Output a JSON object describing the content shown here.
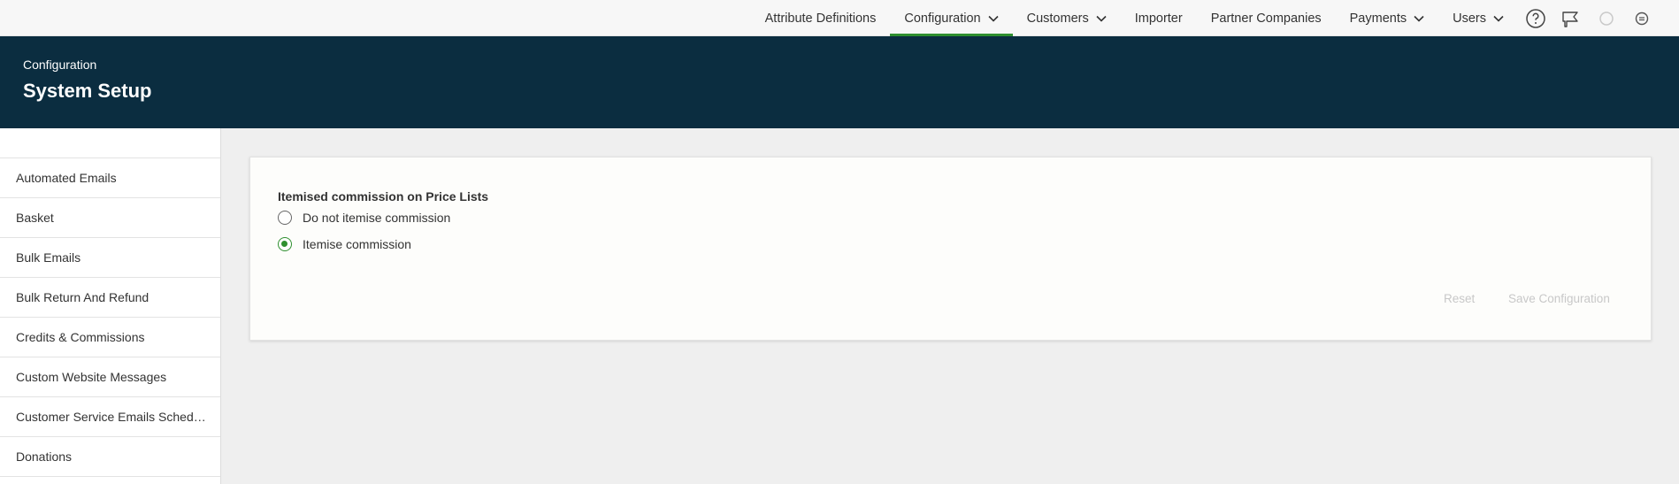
{
  "topnav": {
    "items": [
      {
        "label": "Attribute Definitions",
        "dropdown": false,
        "active": false
      },
      {
        "label": "Configuration",
        "dropdown": true,
        "active": true
      },
      {
        "label": "Customers",
        "dropdown": true,
        "active": false
      },
      {
        "label": "Importer",
        "dropdown": false,
        "active": false
      },
      {
        "label": "Partner Companies",
        "dropdown": false,
        "active": false
      },
      {
        "label": "Payments",
        "dropdown": true,
        "active": false
      },
      {
        "label": "Users",
        "dropdown": true,
        "active": false
      }
    ],
    "icons": [
      "help-icon",
      "megaphone-icon",
      "status-circle-icon",
      "user-badge-icon"
    ],
    "accent_color": "#2f8f2f"
  },
  "header": {
    "breadcrumb": "Configuration",
    "title": "System Setup",
    "background_color": "#0b2d40"
  },
  "sidebar": {
    "items": [
      "Automated Emails",
      "Basket",
      "Bulk Emails",
      "Bulk Return And Refund",
      "Credits & Commissions",
      "Custom Website Messages",
      "Customer Service Emails Schedul...",
      "Donations"
    ]
  },
  "main": {
    "section_label": "Itemised commission on Price Lists",
    "options": [
      {
        "label": "Do not itemise commission",
        "checked": false
      },
      {
        "label": "Itemise commission",
        "checked": true
      }
    ],
    "reset_label": "Reset",
    "save_label": "Save Configuration"
  }
}
